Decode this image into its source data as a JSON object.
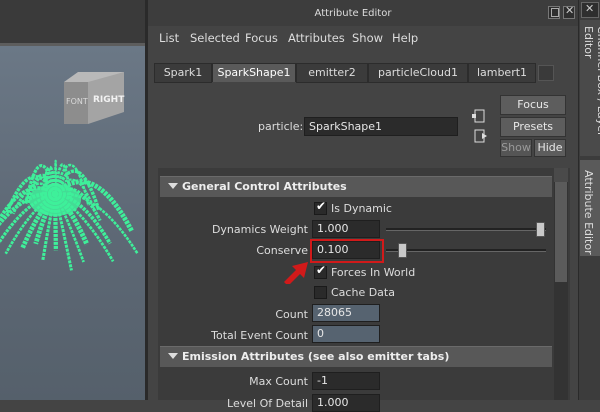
{
  "window": {
    "title": "Attribute Editor"
  },
  "viewcube": {
    "front": "FONT",
    "right": "RIGHT"
  },
  "menu": [
    "List",
    "Selected",
    "Focus",
    "Attributes",
    "Show",
    "Help"
  ],
  "tabs": [
    "Spark1",
    "SparkShape1",
    "emitter2",
    "particleCloud1",
    "lambert1"
  ],
  "active_tab": "SparkShape1",
  "node": {
    "label": "particle:",
    "value": "SparkShape1"
  },
  "buttons": {
    "focus": "Focus",
    "presets": "Presets",
    "show": "Show",
    "hide": "Hide"
  },
  "sections": {
    "general": "General Control Attributes",
    "emission": "Emission Attributes (see also emitter tabs)"
  },
  "attrs": {
    "is_dynamic": {
      "label": "Is Dynamic",
      "checked": true
    },
    "dynamics_weight": {
      "label": "Dynamics Weight",
      "value": "1.000",
      "slider": 1.0
    },
    "conserve": {
      "label": "Conserve",
      "value": "0.100",
      "slider": 0.1
    },
    "forces_in_world": {
      "label": "Forces In World",
      "checked": true
    },
    "cache_data": {
      "label": "Cache Data",
      "checked": false
    },
    "count": {
      "label": "Count",
      "value": "28065"
    },
    "total_event_count": {
      "label": "Total Event Count",
      "value": "0"
    },
    "max_count": {
      "label": "Max Count",
      "value": "-1"
    },
    "level_of_detail": {
      "label": "Level Of Detail",
      "value": "1.000"
    }
  },
  "dock": {
    "channel_box": "Channel Box / Layer Editor",
    "attribute_editor": "Attribute Editor"
  },
  "colors": {
    "particles": "#3ef09a",
    "highlight": "#d11a1a",
    "panel": "#444444"
  }
}
